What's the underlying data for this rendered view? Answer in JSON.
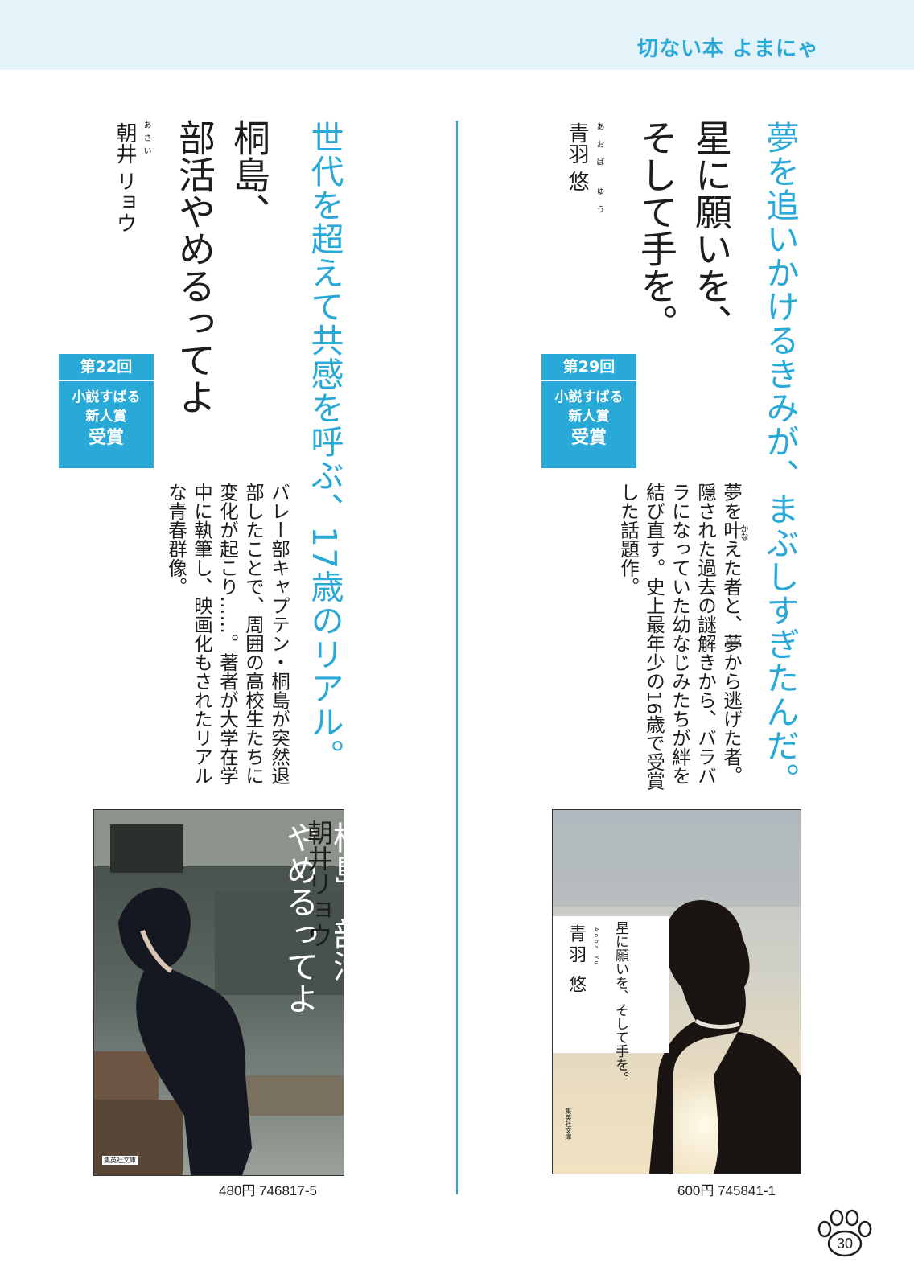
{
  "header": {
    "title": "切ない本 よまにゃ"
  },
  "right_book": {
    "catch": "夢を追いかけるきみが、まぶしすぎたんだ。",
    "title_line1": "星に願いを、",
    "title_line2": "そして手を。",
    "author": "青羽 悠",
    "author_ruby": "あおば ゆう",
    "award": {
      "round": "第29回",
      "name_line1": "小説すばる",
      "name_line2": "新人賞",
      "received": "受賞"
    },
    "blurb": "夢を叶えた者と、夢から逃げた者。隠された過去の謎解きから、バラバラになっていた幼なじみたちが絆を結び直す。史上最年少の16歳で受賞した話題作。",
    "blurb_ruby": "かな",
    "cover": {
      "title": "星に願いを、そして手を。",
      "author": "青羽 悠",
      "romaji": "Aoba Yu",
      "publisher": "集英社文庫"
    },
    "price": "600円 745841-1"
  },
  "left_book": {
    "catch": "世代を超えて共感を呼ぶ、17歳のリアル。",
    "title_line1": "桐島、",
    "title_line2": "部活やめるってよ",
    "author": "朝井 リョウ",
    "author_ruby": "あさい",
    "award": {
      "round": "第22回",
      "name_line1": "小説すばる",
      "name_line2": "新人賞",
      "received": "受賞"
    },
    "blurb": "バレー部キャプテン・桐島が突然退部したことで、周囲の高校生たちに変化が起こり……。著者が大学在学中に執筆し、映画化もされたリアルな青春群像。",
    "cover": {
      "title_line1": "桐島、部活",
      "title_line2": "やめるってよ",
      "author": "朝井リョウ",
      "publisher": "集英社文庫"
    },
    "price": "480円 746817-5"
  },
  "page_number": "30",
  "colors": {
    "accent": "#29a9d8",
    "header_band": "#e4f2fa",
    "text": "#1d1d1b"
  }
}
